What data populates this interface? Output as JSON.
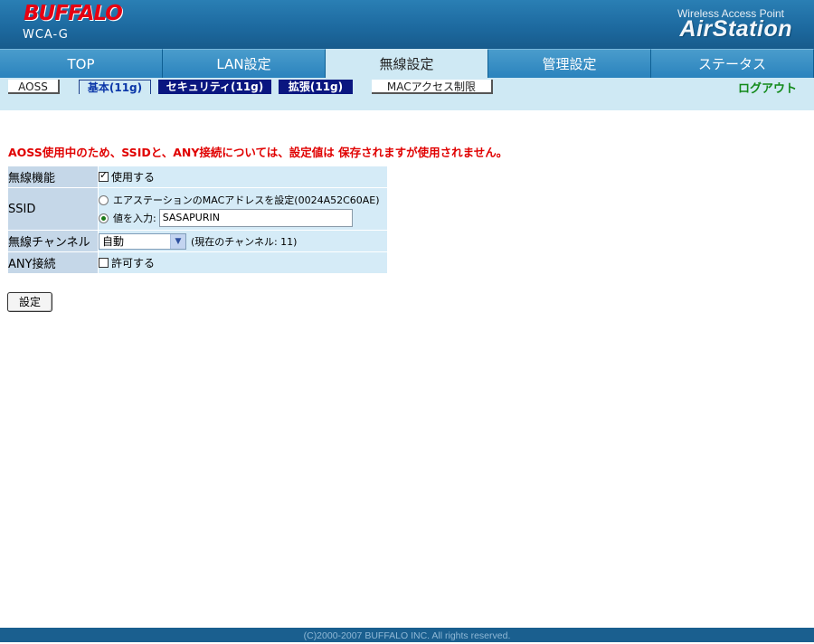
{
  "header": {
    "brand": "BUFFALO",
    "model": "WCA-G",
    "product_sub": "Wireless Access Point",
    "product_name": "AirStation"
  },
  "main_nav": {
    "tabs": [
      {
        "label": "TOP",
        "active": false
      },
      {
        "label": "LAN設定",
        "active": false
      },
      {
        "label": "無線設定",
        "active": true
      },
      {
        "label": "管理設定",
        "active": false
      },
      {
        "label": "ステータス",
        "active": false
      }
    ]
  },
  "sub_nav": {
    "tabs": [
      {
        "label": "AOSS"
      },
      {
        "label": "基本(11g)"
      },
      {
        "label": "セキュリティ(11g)"
      },
      {
        "label": "拡張(11g)"
      },
      {
        "label": "MACアクセス制限"
      }
    ],
    "current": "基本(11g)",
    "logout": "ログアウト"
  },
  "warning": "AOSS使用中のため、SSIDと、ANY接続については、設定値は 保存されますが使用されません。",
  "form": {
    "wireless_function": {
      "label": "無線機能",
      "checkbox_label": "使用する",
      "checked": true
    },
    "ssid": {
      "label": "SSID",
      "option_mac_label": "エアステーションのMACアドレスを設定(0024A52C60AE)",
      "option_value_label": "値を入力:",
      "selected": "value",
      "value": "SASAPURIN"
    },
    "channel": {
      "label": "無線チャンネル",
      "selected": "自動",
      "current_note": "(現在のチャンネル: 11)"
    },
    "any_connection": {
      "label": "ANY接続",
      "checkbox_label": "許可する",
      "checked": false
    },
    "submit_label": "設定"
  },
  "footer": "(C)2000-2007 BUFFALO INC. All rights reserved.",
  "colors": {
    "header_blue": "#1d6aa0",
    "active_tab": "#cfe9f4",
    "warning_red": "#e00000",
    "logout_green": "#128a1a",
    "dark_subtab": "#0a1680"
  }
}
